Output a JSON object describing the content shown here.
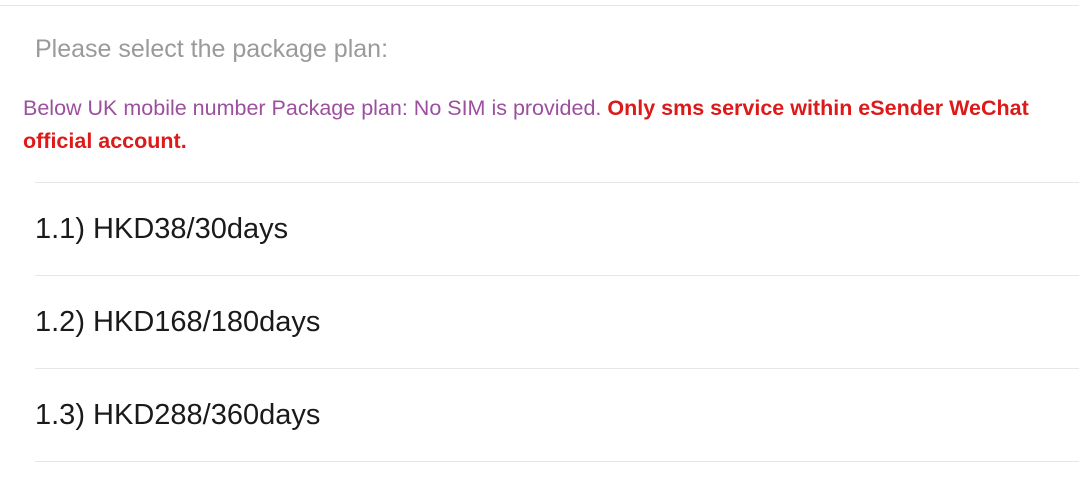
{
  "prompt": "Please select the package plan:",
  "notice": {
    "normal": "Below UK mobile number Package plan: No SIM is provided. ",
    "bold": "Only sms service within eSender WeChat official account."
  },
  "plans": [
    {
      "label": "1.1) HKD38/30days"
    },
    {
      "label": "1.2) HKD168/180days"
    },
    {
      "label": "1.3) HKD288/360days"
    }
  ],
  "colors": {
    "prompt": "#9a9a9a",
    "notice_normal": "#9b4f9e",
    "notice_bold": "#dc1a1a",
    "divider": "#e6e6e6"
  }
}
